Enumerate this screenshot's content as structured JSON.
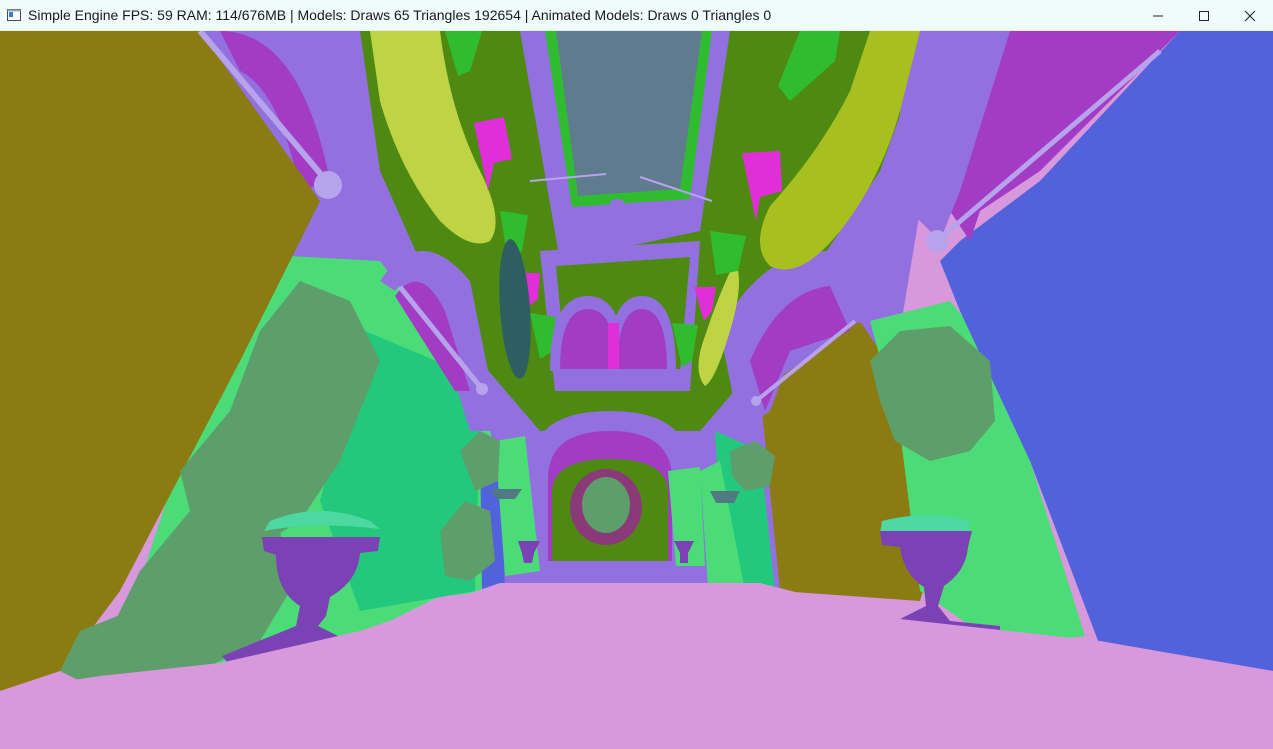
{
  "window": {
    "title": "Simple Engine FPS: 59 RAM: 114/676MB | Models: Draws 65 Triangles 192654 | Animated Models: Draws 0 Triangles 0",
    "app_icon": "window-app-icon",
    "controls": {
      "minimize_icon": "minimize-icon",
      "maximize_icon": "maximize-icon",
      "close_icon": "close-icon"
    }
  },
  "scene": {
    "colors": {
      "floor": "#d898dc",
      "sky_panel": "#5e7c8e",
      "arch_lavender": "#9370e0",
      "arch_magenta": "#a23cc4",
      "olive_wall": "#8a7c12",
      "blue_wall": "#5262dc",
      "green_column": "#4bdc78",
      "teal_column": "#22c97c",
      "moss": "#4e8a12",
      "lime_drape": "#bed445",
      "bright_green": "#2fbd2f",
      "pink_banner": "#e02fd8",
      "ivy": "#5e9e6a",
      "urn": "#7a42b4",
      "fern": "#4cd8a0"
    }
  }
}
